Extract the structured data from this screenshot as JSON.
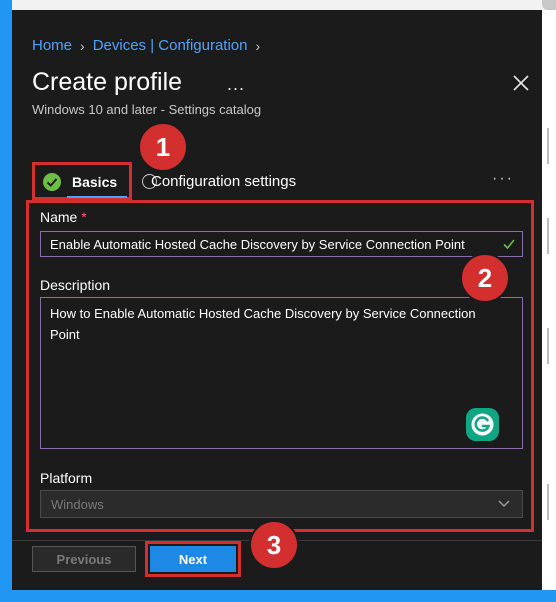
{
  "breadcrumb": [
    "Home",
    "Devices | Configuration"
  ],
  "header": {
    "title": "Create profile",
    "more": "...",
    "subtitle": "Windows 10 and later - Settings catalog"
  },
  "tabs": [
    {
      "label": "Basics",
      "state": "active",
      "icon": "check-circle-icon"
    },
    {
      "label": "Configuration settings",
      "state": "inactive",
      "icon": "circle-icon"
    }
  ],
  "tabs_more": "···",
  "form": {
    "name_label": "Name",
    "required_mark": "*",
    "name_value": "Enable Automatic Hosted Cache Discovery by Service Connection Point",
    "description_label": "Description",
    "description_value": "How to Enable Automatic Hosted Cache Discovery by Service Connection Point",
    "platform_label": "Platform",
    "platform_value": "Windows"
  },
  "footer": {
    "previous_label": "Previous",
    "next_label": "Next"
  },
  "annotations": [
    "1",
    "2",
    "3"
  ],
  "colors": {
    "background": "#2196f3",
    "panel": "#1b1b1b",
    "link": "#4da3ff",
    "annotation_red": "#d32f2f",
    "primary_button": "#1e88e5",
    "success_green": "#6ebd45",
    "grammarly": "#11a683"
  }
}
